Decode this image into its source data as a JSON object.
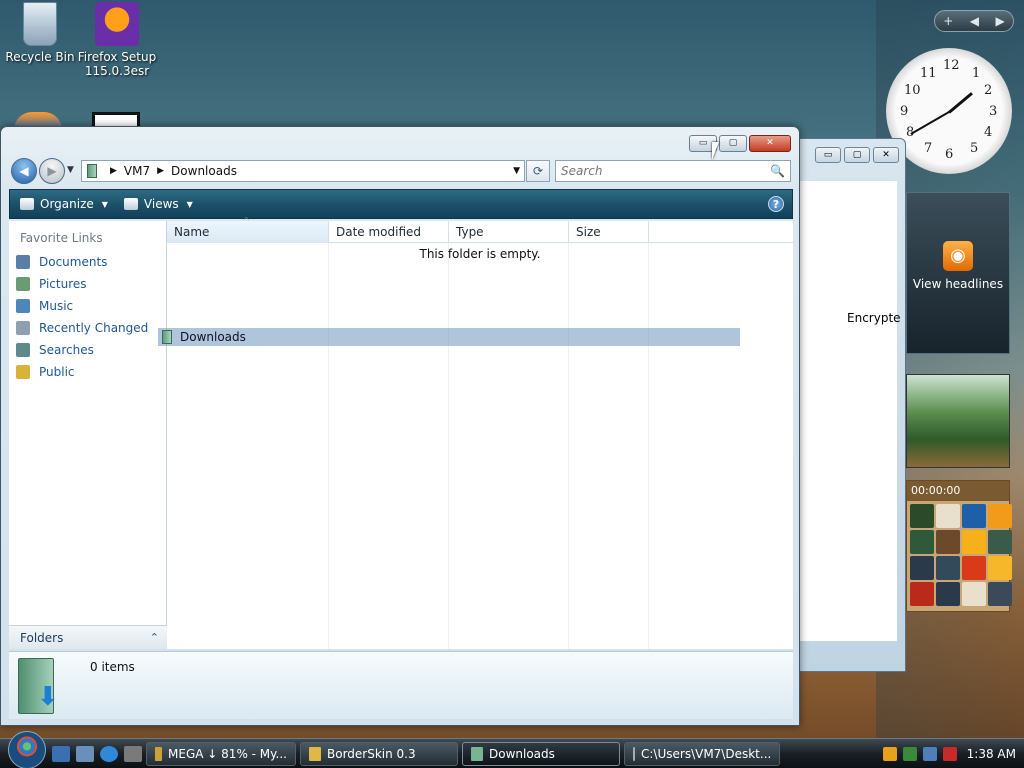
{
  "desktop": {
    "icons": [
      {
        "label": "Recycle Bin"
      },
      {
        "label": "Firefox Setup 115.0.3esr"
      }
    ]
  },
  "sidebar": {
    "nav": {
      "add": "+",
      "prev": "◀",
      "next": "▶"
    },
    "clock_numbers": [
      "12",
      "1",
      "2",
      "3",
      "4",
      "5",
      "6",
      "7",
      "8",
      "9",
      "10",
      "11"
    ],
    "rss_label": "View headlines",
    "puzzle_timer": "00:00:00"
  },
  "back_window": {
    "column_label": "Encrypte",
    "min": "▭",
    "max": "▢",
    "close": "✕"
  },
  "explorer": {
    "buttons": {
      "min": "▭",
      "max": "▢",
      "close": "✕"
    },
    "nav": {
      "back": "◀",
      "forward": "▶",
      "recent": "▼"
    },
    "address": {
      "root_sep": "▶",
      "part1": "VM7",
      "part2": "Downloads",
      "drop": "▼"
    },
    "refresh": "⟳",
    "search": {
      "placeholder": "Search",
      "icon": "🔍"
    },
    "toolbar": {
      "organize": "Organize",
      "views": "Views",
      "help": "?"
    },
    "nav_pane": {
      "header": "Favorite Links",
      "links": [
        {
          "label": "Documents",
          "color": "#5a7fa6"
        },
        {
          "label": "Pictures",
          "color": "#6b9b74"
        },
        {
          "label": "Music",
          "color": "#4d86b8"
        },
        {
          "label": "Recently Changed",
          "color": "#8c9fb2"
        },
        {
          "label": "Searches",
          "color": "#5f8a8c"
        },
        {
          "label": "Public",
          "color": "#d9b23a"
        }
      ],
      "folders": "Folders",
      "folders_chevron": "⌃"
    },
    "columns": [
      "Name",
      "Date modified",
      "Type",
      "Size"
    ],
    "sort_arrow": "^",
    "empty_message": "This folder is empty.",
    "drag_item": "Downloads",
    "details": {
      "count": "0 items",
      "arrow": "⬇"
    }
  },
  "taskbar": {
    "tasks": [
      {
        "label": "MEGA ↓ 81% - My...",
        "color": "#c9a23a"
      },
      {
        "label": "BorderSkin 0.3",
        "color": "#e0b84a"
      },
      {
        "label": "Downloads",
        "color": "#79b594"
      },
      {
        "label": "C:\\Users\\VM7\\Deskt...",
        "color": "#3a3a3a"
      }
    ],
    "time": "1:38 AM"
  }
}
